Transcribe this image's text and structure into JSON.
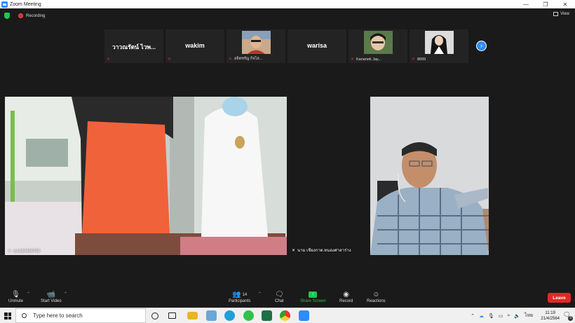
{
  "window": {
    "title": "Zoom Meeting"
  },
  "status": {
    "recording_label": "Recording",
    "view_label": "View"
  },
  "strip": [
    {
      "name": "วาวณรัตน์ ไวพ..."
    },
    {
      "name": "wakim"
    },
    {
      "name": "อจิตชรัญ กิจไส...",
      "has_photo": true
    },
    {
      "name": "warisa"
    },
    {
      "name": "Kananek Jay...",
      "has_photo": true
    },
    {
      "name": "8899",
      "has_photo": true
    }
  ],
  "videos": [
    {
      "label": "svr123456789"
    },
    {
      "label": "นาม เชียงกาด.หนองศาลาร่าง"
    },
    {
      "label": ""
    }
  ],
  "toolbar": {
    "unmute": "Unmute",
    "start_video": "Start Video",
    "participants": "Participants",
    "participants_count": "14",
    "chat": "Chat",
    "share_screen": "Share Screen",
    "record": "Record",
    "reactions": "Reactions",
    "leave": "Leave"
  },
  "taskbar": {
    "search_placeholder": "Type here to search",
    "time": "11:19",
    "date": "21/4/2564",
    "language": "ไทย",
    "notification_count": "3"
  },
  "colors": {
    "accent": "#2d8cff",
    "leave": "#e02828",
    "share": "#23c552"
  }
}
